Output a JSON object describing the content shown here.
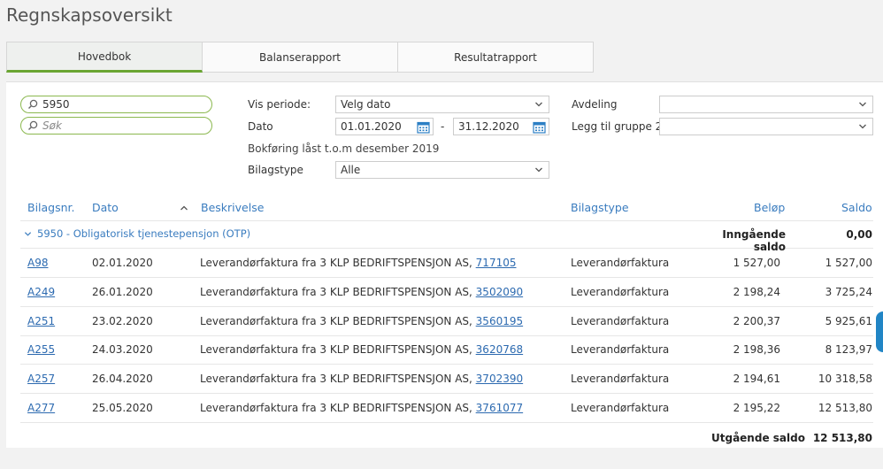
{
  "page": {
    "title": "Regnskapsoversikt"
  },
  "tabs": [
    {
      "label": "Hovedbok",
      "active": true
    },
    {
      "label": "Balanserapport",
      "active": false
    },
    {
      "label": "Resultatrapport",
      "active": false
    }
  ],
  "filters": {
    "search_account_value": "5950",
    "search_placeholder": "Søk",
    "vis_periode_label": "Vis periode:",
    "vis_periode_value": "Velg dato",
    "dato_label": "Dato",
    "date_from": "01.01.2020",
    "date_separator": "-",
    "date_to": "31.12.2020",
    "lock_info": "Bokføring låst t.o.m desember 2019",
    "bilagstype_label": "Bilagstype",
    "bilagstype_value": "Alle",
    "avdeling_label": "Avdeling",
    "avdeling_value": "",
    "gruppe_label": "Legg til gruppe 2",
    "gruppe_value": ""
  },
  "table": {
    "headers": {
      "nr": "Bilagsnr.",
      "dato": "Dato",
      "beskrivelse": "Beskrivelse",
      "bilagstype": "Bilagstype",
      "belop": "Beløp",
      "saldo": "Saldo"
    },
    "group": {
      "label": "5950 - Obligatorisk tjenestepensjon (OTP)",
      "opening_label": "Inngående saldo",
      "opening_value": "0,00"
    },
    "rows": [
      {
        "nr": "A98",
        "dato": "02.01.2020",
        "desc": "Leverandørfaktura fra 3 KLP BEDRIFTSPENSJON AS, ",
        "ref": "717105",
        "type": "Leverandørfaktura",
        "belop": "1 527,00",
        "saldo": "1 527,00"
      },
      {
        "nr": "A249",
        "dato": "26.01.2020",
        "desc": "Leverandørfaktura fra 3 KLP BEDRIFTSPENSJON AS, ",
        "ref": "3502090",
        "type": "Leverandørfaktura",
        "belop": "2 198,24",
        "saldo": "3 725,24"
      },
      {
        "nr": "A251",
        "dato": "23.02.2020",
        "desc": "Leverandørfaktura fra 3 KLP BEDRIFTSPENSJON AS, ",
        "ref": "3560195",
        "type": "Leverandørfaktura",
        "belop": "2 200,37",
        "saldo": "5 925,61"
      },
      {
        "nr": "A255",
        "dato": "24.03.2020",
        "desc": "Leverandørfaktura fra 3 KLP BEDRIFTSPENSJON AS, ",
        "ref": "3620768",
        "type": "Leverandørfaktura",
        "belop": "2 198,36",
        "saldo": "8 123,97"
      },
      {
        "nr": "A257",
        "dato": "26.04.2020",
        "desc": "Leverandørfaktura fra 3 KLP BEDRIFTSPENSJON AS, ",
        "ref": "3702390",
        "type": "Leverandørfaktura",
        "belop": "2 194,61",
        "saldo": "10 318,58"
      },
      {
        "nr": "A277",
        "dato": "25.05.2020",
        "desc": "Leverandørfaktura fra 3 KLP BEDRIFTSPENSJON AS, ",
        "ref": "3761077",
        "type": "Leverandørfaktura",
        "belop": "2 195,22",
        "saldo": "12 513,80"
      }
    ],
    "closing_label": "Utgående saldo",
    "closing_value": "12 513,80"
  },
  "icons": {
    "search": "search-icon",
    "calendar": "calendar-icon",
    "chevron": "chevron-down-icon",
    "sort": "sort-ascending-icon"
  },
  "colors": {
    "accent_green": "#6aa532",
    "link_blue": "#2c6ab0",
    "header_blue": "#3a7cbf",
    "side_tab_blue": "#2185c5"
  }
}
